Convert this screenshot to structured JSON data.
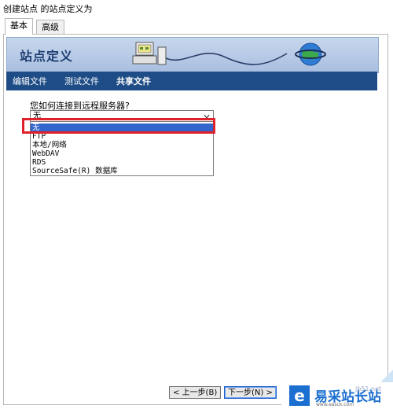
{
  "window": {
    "title": "创建站点 的站点定义为"
  },
  "tabs": [
    {
      "label": "基本"
    },
    {
      "label": "高级"
    }
  ],
  "banner": {
    "title": "站点定义"
  },
  "nav": {
    "items": [
      {
        "label": "编辑文件"
      },
      {
        "label": "测试文件"
      },
      {
        "label": "共享文件"
      }
    ]
  },
  "form": {
    "question": "您如何连接到远程服务器?",
    "select_value": "无",
    "options": [
      {
        "label": "无"
      },
      {
        "label": "FTP"
      },
      {
        "label": "本地/网络"
      },
      {
        "label": "WebDAV"
      },
      {
        "label": "RDS"
      },
      {
        "label": "SourceSafe(R) 数据库"
      }
    ],
    "selected_option": "无"
  },
  "buttons": {
    "back": "< 上一步(B)",
    "next": "下一步(N) >"
  },
  "watermark": {
    "brand": "易采站长站",
    "url": "jb51.net",
    "sub": "www.easck.com"
  },
  "colors": {
    "nav_bg": "#1e4c86",
    "highlight": "#e0202a",
    "selection": "#3366cc"
  }
}
